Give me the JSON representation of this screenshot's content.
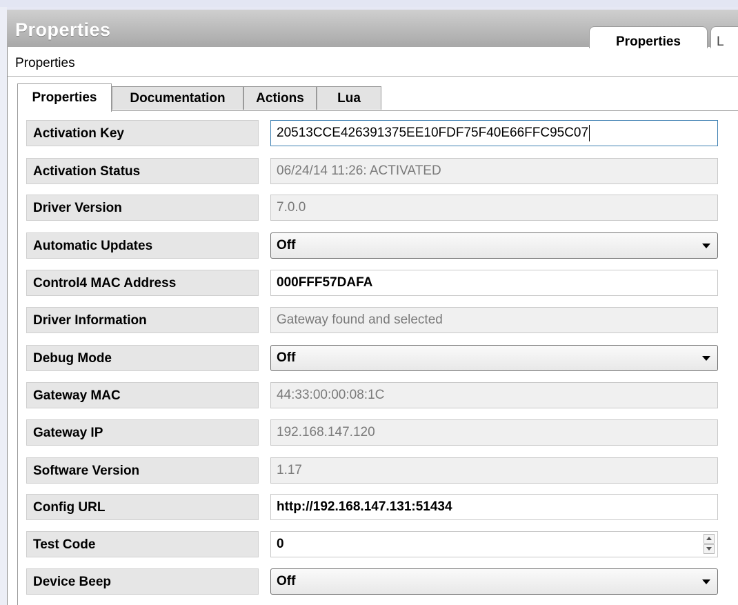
{
  "window": {
    "title": "Properties",
    "header_tabs": [
      "Properties",
      "L"
    ]
  },
  "subheader": "Properties",
  "tabs": [
    "Properties",
    "Documentation",
    "Actions",
    "Lua"
  ],
  "properties": [
    {
      "label": "Activation Key",
      "value": "20513CCE426391375EE10FDF75F40E66FFC95C07"
    },
    {
      "label": "Activation Status",
      "value": "06/24/14 11:26: ACTIVATED"
    },
    {
      "label": "Driver Version",
      "value": "7.0.0"
    },
    {
      "label": "Automatic Updates",
      "value": "Off"
    },
    {
      "label": "Control4 MAC Address",
      "value": "000FFF57DAFA"
    },
    {
      "label": "Driver Information",
      "value": "Gateway found and selected"
    },
    {
      "label": "Debug Mode",
      "value": "Off"
    },
    {
      "label": "Gateway MAC",
      "value": "44:33:00:00:08:1C"
    },
    {
      "label": "Gateway IP",
      "value": "192.168.147.120"
    },
    {
      "label": "Software Version",
      "value": "1.17"
    },
    {
      "label": "Config URL",
      "value": "http://192.168.147.131:51434"
    },
    {
      "label": "Test Code",
      "value": "0"
    },
    {
      "label": "Device Beep",
      "value": "Off"
    }
  ]
}
